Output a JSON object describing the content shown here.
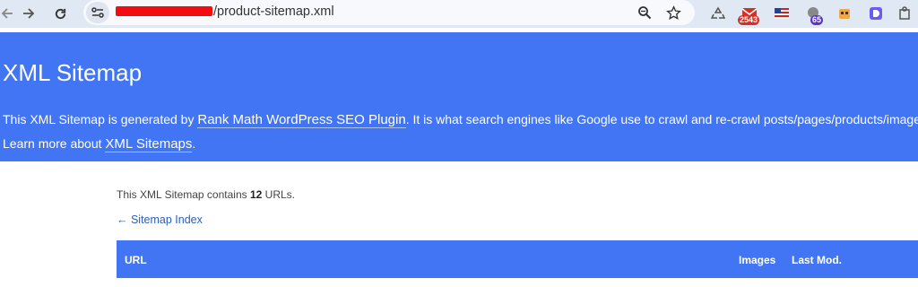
{
  "browser": {
    "url_visible": "/product-sitemap.xml",
    "badges": {
      "mail": "2543",
      "ext3": "65"
    }
  },
  "header": {
    "title": "XML Sitemap",
    "line1_prefix": "This XML Sitemap is generated by ",
    "line1_link": "Rank Math WordPress SEO Plugin",
    "line1_suffix": ". It is what search engines like Google use to crawl and re-crawl posts/pages/products/images/archi",
    "line2_prefix": "Learn more about ",
    "line2_link": "XML Sitemaps",
    "line2_suffix": "."
  },
  "main": {
    "count_prefix": "This XML Sitemap contains ",
    "count_value": "12",
    "count_suffix": " URLs.",
    "index_link": "← Sitemap Index",
    "table": {
      "columns": [
        "URL",
        "Images",
        "Last Mod."
      ]
    }
  },
  "colors": {
    "header_bg": "#4275f4",
    "link": "#2a5fb8",
    "chrome_bg": "#dfe8f3"
  }
}
